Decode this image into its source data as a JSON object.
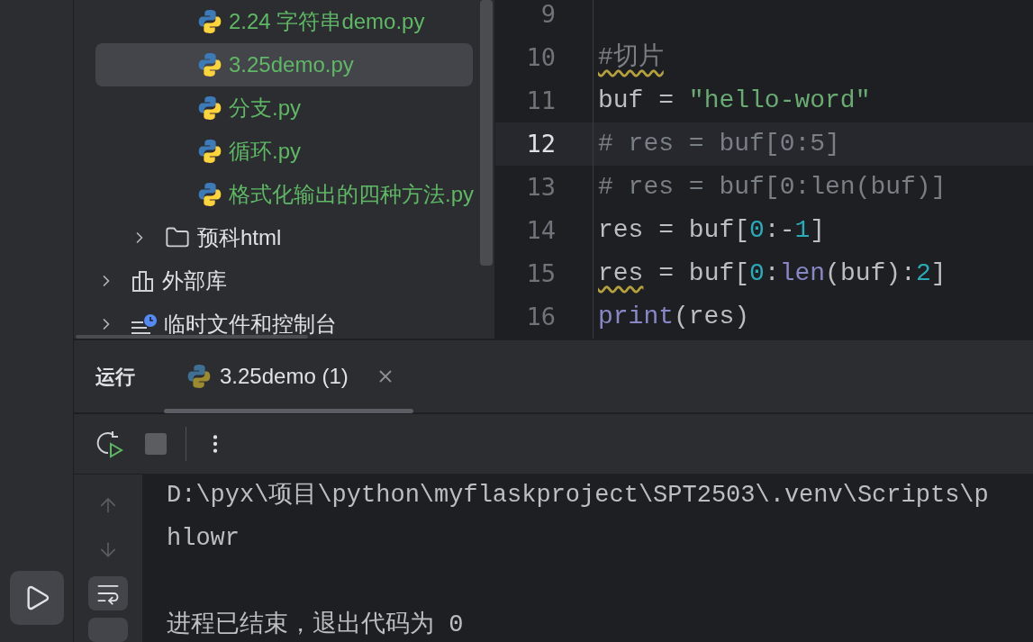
{
  "project_tree": {
    "items": [
      {
        "children": [
          {
            "children": [
              {
                "kind": "file",
                "label": "2.24 字符串demo.py",
                "selected": false,
                "color": "#5fb865"
              },
              {
                "kind": "file",
                "label": "3.25demo.py",
                "selected": true,
                "color": "#5fb865"
              },
              {
                "kind": "file",
                "label": "分支.py",
                "selected": false,
                "color": "#5fb865"
              },
              {
                "kind": "file",
                "label": "循环.py",
                "selected": false,
                "color": "#5fb865"
              },
              {
                "kind": "file",
                "label": "格式化输出的四种方法.py",
                "selected": false,
                "color": "#5fb865"
              }
            ]
          },
          {
            "kind": "folder",
            "label": "预科html",
            "expanded": false,
            "selected": false,
            "color": "#dfe1e5"
          }
        ]
      },
      {
        "kind": "library",
        "label": "外部库",
        "expanded": false,
        "selected": false,
        "color": "#dfe1e5"
      },
      {
        "kind": "scratches",
        "label": "临时文件和控制台",
        "expanded": false,
        "selected": false,
        "color": "#dfe1e5"
      }
    ]
  },
  "editor": {
    "lines": [
      {
        "number": "9",
        "current": false
      },
      {
        "number": "10",
        "current": false,
        "tokens": [
          {
            "kind": "comment",
            "text": "#切片",
            "warning": true
          }
        ]
      },
      {
        "number": "11",
        "current": false,
        "tokens": [
          {
            "kind": "plain",
            "text": "buf = "
          },
          {
            "kind": "string",
            "text": "\"hello-word\""
          }
        ]
      },
      {
        "number": "12",
        "current": true,
        "tokens": [
          {
            "kind": "comment",
            "text": "# res = buf[0:5]"
          }
        ]
      },
      {
        "number": "13",
        "current": false,
        "tokens": [
          {
            "kind": "comment",
            "text": "# res = buf[0:len(buf)]"
          }
        ]
      },
      {
        "number": "14",
        "current": false,
        "tokens": [
          {
            "kind": "plain",
            "text": "res = buf["
          },
          {
            "kind": "number",
            "text": "0"
          },
          {
            "kind": "plain",
            "text": ":-"
          },
          {
            "kind": "number",
            "text": "1"
          },
          {
            "kind": "plain",
            "text": "]"
          }
        ]
      },
      {
        "number": "15",
        "current": false,
        "tokens": [
          {
            "kind": "plain",
            "text": "res",
            "warning": true
          },
          {
            "kind": "plain",
            "text": " = buf["
          },
          {
            "kind": "number",
            "text": "0"
          },
          {
            "kind": "plain",
            "text": ":"
          },
          {
            "kind": "builtin",
            "text": "len"
          },
          {
            "kind": "plain",
            "text": "(buf):"
          },
          {
            "kind": "number",
            "text": "2"
          },
          {
            "kind": "plain",
            "text": "]"
          }
        ]
      },
      {
        "number": "16",
        "current": false,
        "tokens": [
          {
            "kind": "builtin",
            "text": "print"
          },
          {
            "kind": "plain",
            "text": "(res)"
          }
        ]
      }
    ]
  },
  "run_panel": {
    "title": "运行",
    "tabs": [
      {
        "label": "3.25demo (1)",
        "selected": true
      }
    ],
    "console": [
      [
        "D:\\pyx\\项目\\python\\myflaskproject\\SPT2503\\.venv\\Scripts\\p",
        "hlowr"
      ],
      [
        "进程已结束，退出代码为 0"
      ]
    ]
  }
}
